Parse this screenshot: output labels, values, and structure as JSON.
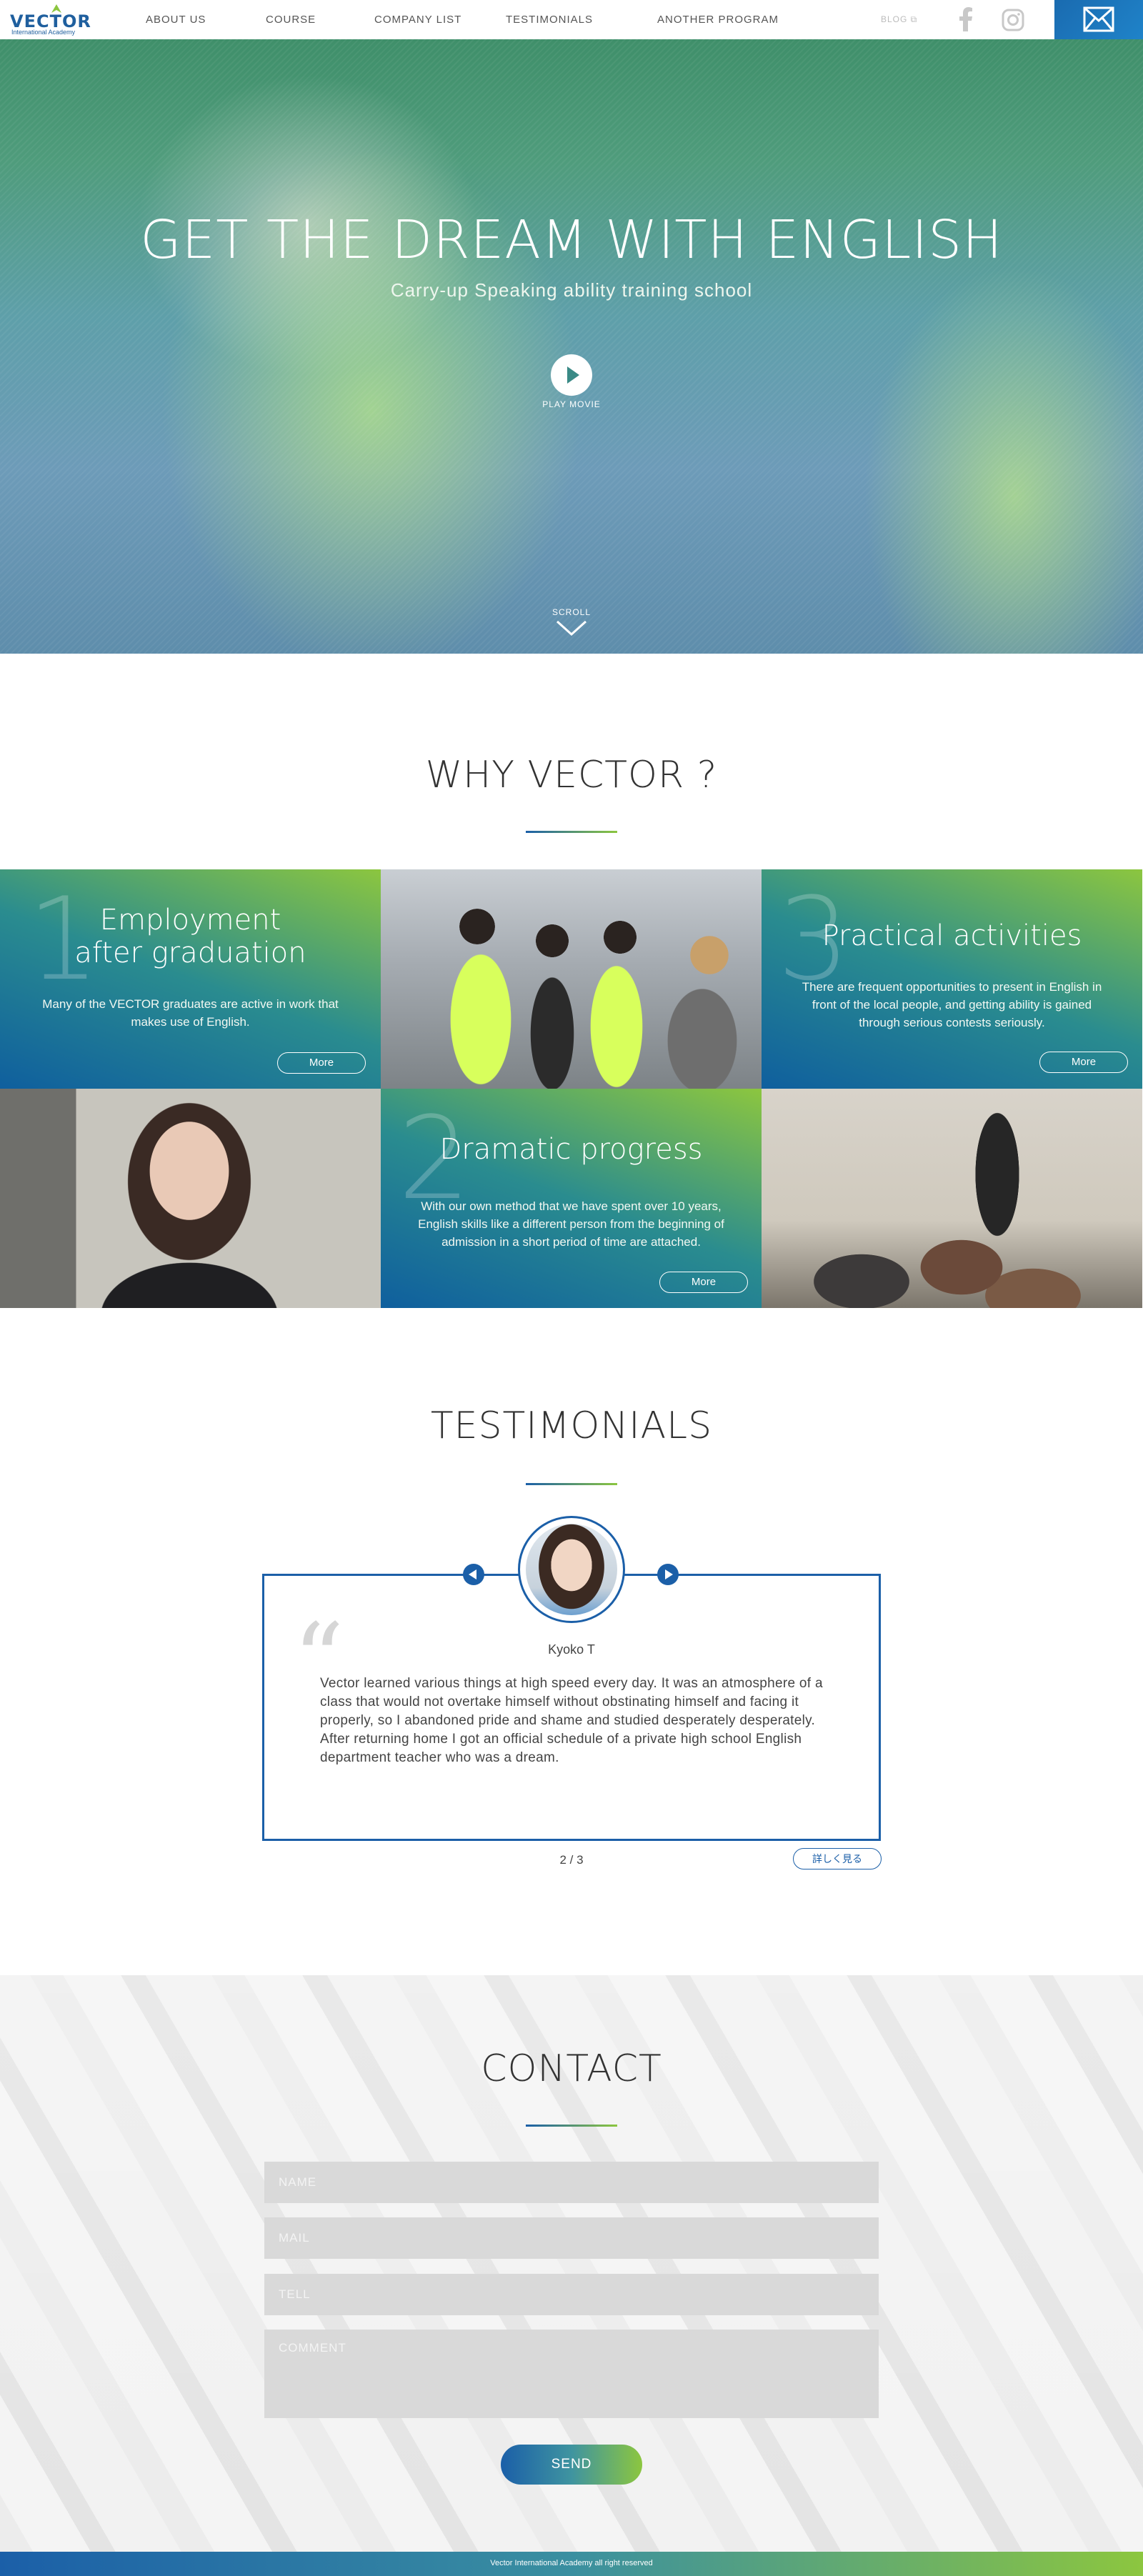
{
  "header": {
    "logo_text": "VECTOR",
    "logo_sub": "International Academy",
    "nav": [
      "ABOUT US",
      "COURSE",
      "COMPANY LIST",
      "TESTIMONIALS",
      "ANOTHER PROGRAM"
    ],
    "blog": "BLOG ⧉",
    "icons": [
      "facebook-icon",
      "instagram-icon",
      "mail-icon"
    ]
  },
  "hero": {
    "title": "GET THE DREAM WITH ENGLISH",
    "subtitle": "Carry-up Speaking ability training school",
    "play_label": "PLAY MOVIE",
    "scroll_label": "SCROLL"
  },
  "why": {
    "title": "WHY VECTOR ?",
    "items": [
      {
        "number": "1",
        "title_line1": "Employment",
        "title_line2": "after graduation",
        "body": "Many of the VECTOR graduates are active in work that makes use of English.",
        "more": "More"
      },
      {
        "number": "3",
        "title_line1": "Practical activities",
        "body": "There are frequent opportunities to present in English in front of the local people, and getting ability is gained through serious contests seriously.",
        "more": "More"
      },
      {
        "number": "2",
        "title_line1": "Dramatic progress",
        "body": "With our own method that we have spent over 10 years, English skills like a different person from the beginning of admission in a short period of time are attached.",
        "more": "More"
      }
    ]
  },
  "testimonials": {
    "title": "TESTIMONIALS",
    "name": "Kyoko T",
    "quote_mark": "“",
    "text": "Vector learned various things at high speed every day. It was an atmosphere of a class that would not overtake himself without obstinating himself and facing it properly, so I abandoned pride and shame and studied desperately desperately. After returning home I got an official schedule of a private high school English department teacher who was a dream.",
    "page": "2 / 3",
    "detail": "詳しく見る"
  },
  "contact": {
    "title": "CONTACT",
    "name_placeholder": "NAME",
    "mail_placeholder": "MAIL",
    "tell_placeholder": "TELL",
    "comment_placeholder": "COMMENT",
    "send": "SEND"
  },
  "footer": {
    "copyright": "Vector International Academy all right reserved"
  },
  "colors": {
    "brand_blue": "#1b5fa8",
    "brand_green": "#8cc63f"
  }
}
